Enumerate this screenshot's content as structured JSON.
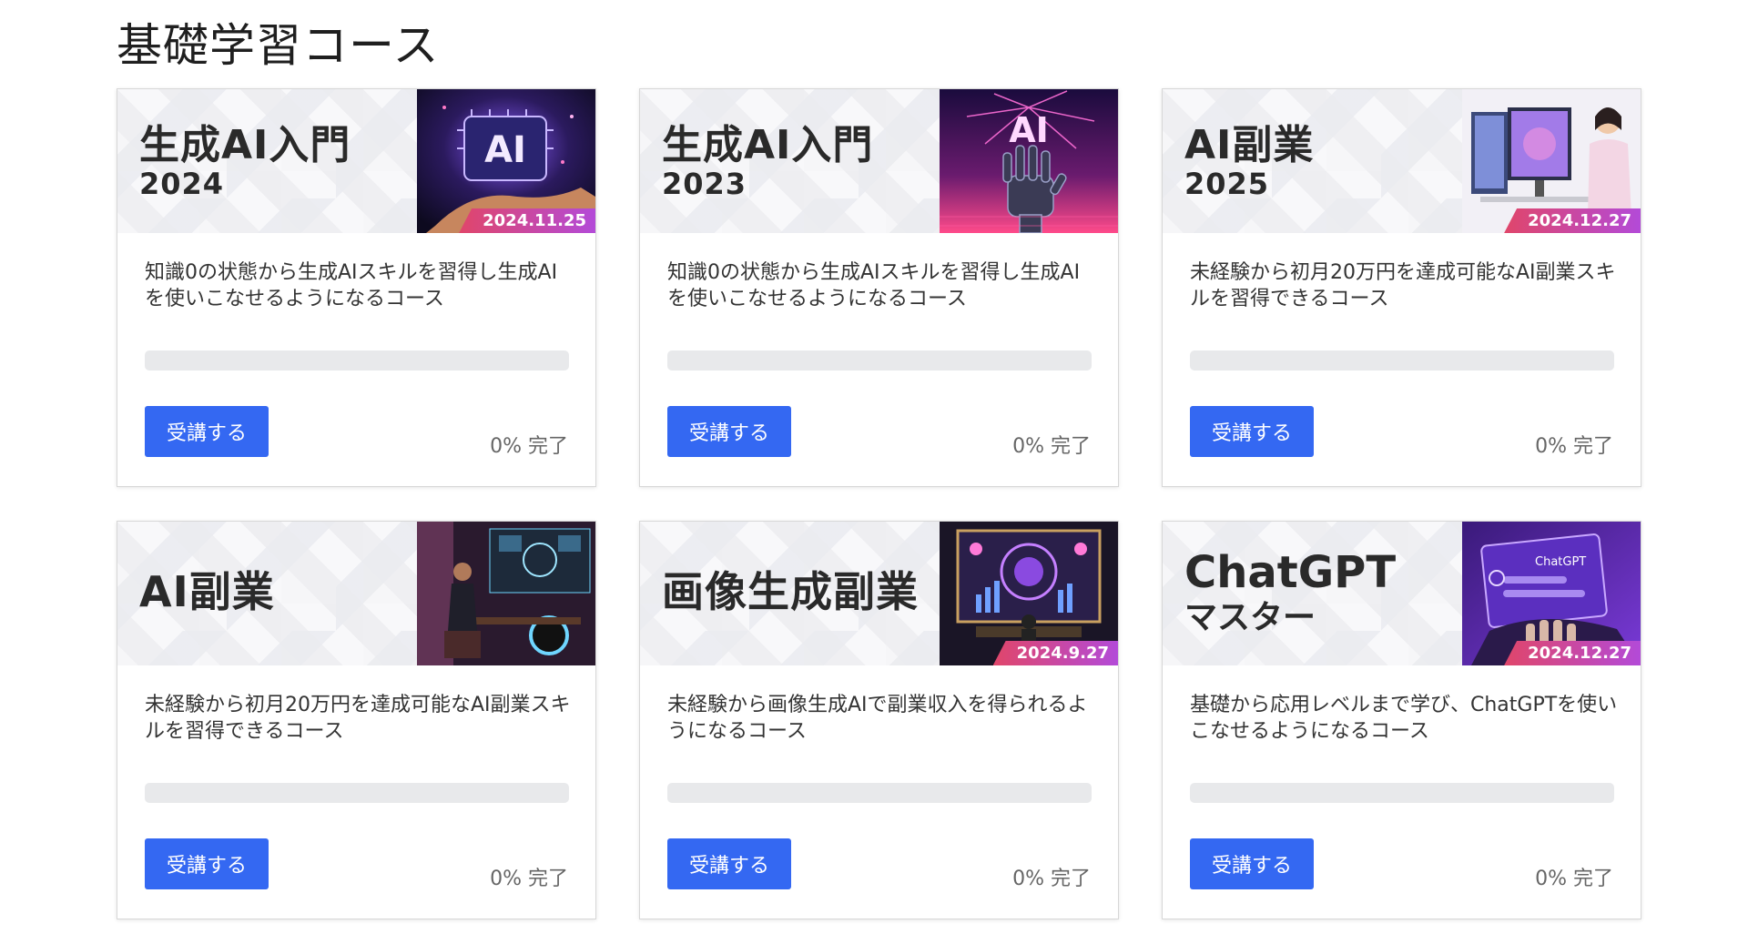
{
  "page_title": "基礎学習コース",
  "courses": [
    {
      "title": "生成AI入門",
      "subtitle": "2024",
      "date": "2024.11.25",
      "description": "知識0の状態から生成AIスキルを習得し生成AIを使いこなせるようになるコース",
      "progress_percent": 0,
      "button_label": "受講する",
      "percent_text": "0%",
      "done_text": "完了"
    },
    {
      "title": "生成AI入門",
      "subtitle": "2023",
      "date": "",
      "description": "知識0の状態から生成AIスキルを習得し生成AIを使いこなせるようになるコース",
      "progress_percent": 0,
      "button_label": "受講する",
      "percent_text": "0%",
      "done_text": "完了"
    },
    {
      "title": "AI副業",
      "subtitle": "2025",
      "date": "2024.12.27",
      "description": "未経験から初月20万円を達成可能なAI副業スキルを習得できるコース",
      "progress_percent": 0,
      "button_label": "受講する",
      "percent_text": "0%",
      "done_text": "完了"
    },
    {
      "title": "AI副業",
      "subtitle": "",
      "date": "",
      "description": "未経験から初月20万円を達成可能なAI副業スキルを習得できるコース",
      "progress_percent": 0,
      "button_label": "受講する",
      "percent_text": "0%",
      "done_text": "完了"
    },
    {
      "title": "画像生成副業",
      "subtitle": "",
      "date": "2024.9.27",
      "description": "未経験から画像生成AIで副業収入を得られるようになるコース",
      "progress_percent": 0,
      "button_label": "受講する",
      "percent_text": "0%",
      "done_text": "完了"
    },
    {
      "title": "ChatGPT",
      "subtitle": "マスター",
      "date": "2024.12.27",
      "description": "基礎から応用レベルまで学び、ChatGPTを使いこなせるようになるコース",
      "progress_percent": 0,
      "button_label": "受講する",
      "percent_text": "0%",
      "done_text": "完了"
    }
  ],
  "thumb_text": {
    "ai_chip": "AI",
    "ai_neon": "AI",
    "chatgpt_screen": "ChatGPT"
  },
  "colors": {
    "button": "#3468f2",
    "badge_start": "#e0466a",
    "badge_end": "#b34ad8",
    "progress_track": "#e8e9eb"
  }
}
